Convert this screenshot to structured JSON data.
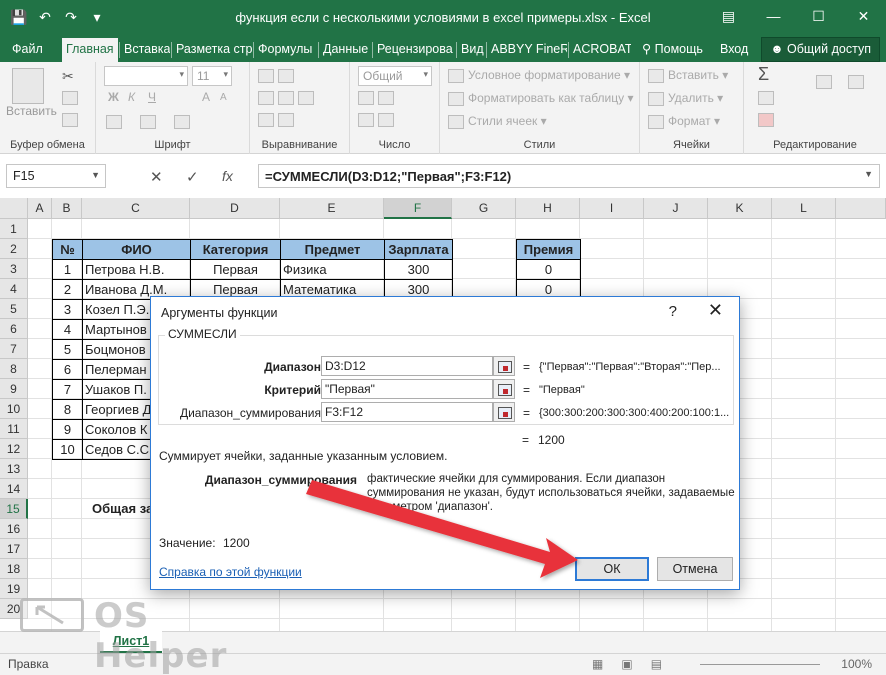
{
  "app": {
    "title": "функция если с несколькими условиями в excel примеры.xlsx - Excel",
    "qat": [
      "save-icon",
      "undo-icon",
      "redo-icon",
      "customize-icon"
    ],
    "window_controls": [
      "ribbon-display-icon",
      "minimize-icon",
      "maximize-icon",
      "close-icon"
    ]
  },
  "tabs": [
    "Файл",
    "Главная",
    "Вставка",
    "Разметка стр",
    "Формулы",
    "Данные",
    "Рецензирова",
    "Вид",
    "ABBYY FineRe",
    "ACROBAT"
  ],
  "tellme": "Помощь",
  "signin": "Вход",
  "share": "Общий доступ",
  "ribbon": {
    "clipboard": {
      "paste": "Вставить",
      "label": "Буфер обмена"
    },
    "font": {
      "name": "",
      "size": "11",
      "bold": "Ж",
      "italic": "К",
      "underline": "Ч",
      "grow": "A",
      "shrink": "A",
      "label": "Шрифт"
    },
    "alignment": {
      "label": "Выравнивание"
    },
    "number": {
      "format": "Общий",
      "label": "Число"
    },
    "styles": {
      "conditional": "Условное форматирование",
      "table": "Форматировать как таблицу",
      "cell": "Стили ячеек",
      "label": "Стили"
    },
    "cells": {
      "insert": "Вставить",
      "delete": "Удалить",
      "format": "Формат",
      "label": "Ячейки"
    },
    "editing": {
      "label": "Редактирование"
    }
  },
  "formula_bar": {
    "name_box": "F15",
    "cancel": "✕",
    "enter": "✓",
    "fx": "fx",
    "formula": "=СУММЕСЛИ(D3:D12;\"Первая\";F3:F12)"
  },
  "columns": [
    "A",
    "B",
    "C",
    "D",
    "E",
    "F",
    "G",
    "H",
    "I",
    "J",
    "K",
    "L"
  ],
  "rows": [
    "1",
    "2",
    "3",
    "4",
    "5",
    "6",
    "7",
    "8",
    "9",
    "10",
    "11",
    "12",
    "13",
    "14",
    "15",
    "16",
    "17",
    "18",
    "19",
    "20"
  ],
  "table": {
    "headers": [
      "№",
      "ФИО",
      "Категория",
      "Предмет",
      "Зарплата"
    ],
    "rows": [
      [
        "1",
        "Петрова Н.В.",
        "Первая",
        "Физика",
        "300"
      ],
      [
        "2",
        "Иванова Д.М.",
        "Первая",
        "Математика",
        "300"
      ],
      [
        "3",
        "Козел П.Э.",
        "",
        "",
        ""
      ],
      [
        "4",
        "Мартынов",
        "",
        "",
        ""
      ],
      [
        "5",
        "Боцмонов",
        "",
        "",
        ""
      ],
      [
        "6",
        "Пелерман",
        "",
        "",
        ""
      ],
      [
        "7",
        "Ушаков П.",
        "",
        "",
        ""
      ],
      [
        "8",
        "Георгиев Д",
        "",
        "",
        ""
      ],
      [
        "9",
        "Соколов К",
        "",
        "",
        ""
      ],
      [
        "10",
        "Седов С.С.",
        "",
        "",
        ""
      ]
    ]
  },
  "bonus": {
    "header": "Премия",
    "values": [
      "0",
      "0"
    ]
  },
  "total_label": "Общая за",
  "sheet_tab": "Лист1",
  "status": {
    "ready": "Правка",
    "zoom": "100%"
  },
  "watermark": "OS Helper",
  "dialog": {
    "title": "Аргументы функции",
    "help": "?",
    "close": "✕",
    "function_name": "СУММЕСЛИ",
    "args": [
      {
        "label": "Диапазон",
        "value": "D3:D12",
        "result": "{\"Первая\":\"Первая\":\"Вторая\":\"Пер..."
      },
      {
        "label": "Критерий",
        "value": "\"Первая\"",
        "result": "\"Первая\""
      },
      {
        "label": "Диапазон_суммирования",
        "value": "F3:F12",
        "result": "{300:300:200:300:300:400:200:100:1..."
      }
    ],
    "equals": "=",
    "total_result": "1200",
    "description": "Суммирует ячейки, заданные указанным условием.",
    "param_name": "Диапазон_суммирования",
    "param_desc_1": "фактические ячейки для суммирования. Если диапазон",
    "param_desc_2": "суммирования не указан, будут использоваться ячейки, задаваемые",
    "param_desc_3": "параметром 'диапазон'.",
    "value_label": "Значение:",
    "value": "1200",
    "help_link": "Справка по этой функции",
    "ok": "ОК",
    "cancel": "Отмена"
  },
  "colors": {
    "excel_green": "#217346",
    "header_fill": "#9dc3e6",
    "arrow": "#e8333a",
    "dialog_border": "#2d7ad6"
  }
}
